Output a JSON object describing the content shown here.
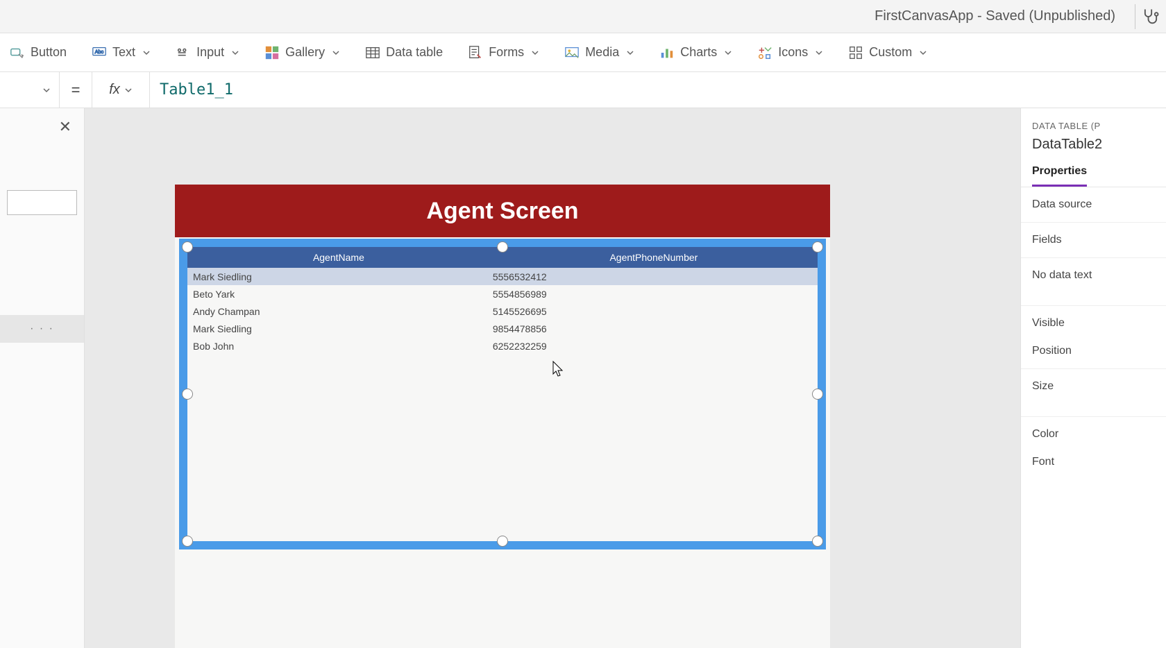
{
  "titlebar": {
    "title": "FirstCanvasApp - Saved (Unpublished)"
  },
  "ribbon": {
    "button": "Button",
    "text": "Text",
    "input": "Input",
    "gallery": "Gallery",
    "datatable": "Data table",
    "forms": "Forms",
    "media": "Media",
    "charts": "Charts",
    "icons": "Icons",
    "custom": "Custom"
  },
  "formulabar": {
    "equals": "=",
    "fx": "fx",
    "value": "Table1_1"
  },
  "leftpanel": {
    "ellipsis": "· · ·"
  },
  "screen": {
    "title": "Agent Screen"
  },
  "datatable": {
    "columns": [
      "AgentName",
      "AgentPhoneNumber"
    ],
    "rows": [
      {
        "name": "Mark Siedling",
        "phone": "5556532412"
      },
      {
        "name": "Beto Yark",
        "phone": "5554856989"
      },
      {
        "name": "Andy Champan",
        "phone": "5145526695"
      },
      {
        "name": "Mark Siedling",
        "phone": "9854478856"
      },
      {
        "name": "Bob John",
        "phone": "6252232259"
      }
    ]
  },
  "rightpanel": {
    "caption": "DATA TABLE (P",
    "control_name": "DataTable2",
    "tabs": {
      "properties": "Properties"
    },
    "rows": {
      "datasource": "Data source",
      "fields": "Fields",
      "nodatatext": "No data text",
      "visible": "Visible",
      "position": "Position",
      "size": "Size",
      "color": "Color",
      "font": "Font"
    }
  }
}
